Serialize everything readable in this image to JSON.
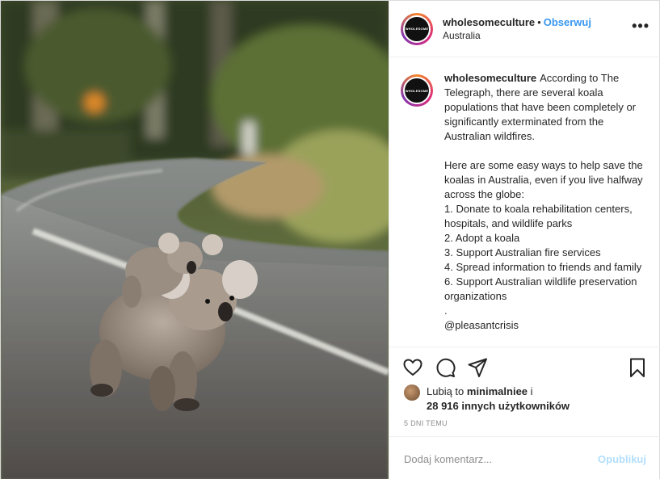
{
  "post": {
    "username": "wholesomeculture",
    "separator": "•",
    "follow_label": "Obserwuj",
    "location": "Australia",
    "more_label": "•••",
    "avatar_text": "WHOLESOME",
    "caption": "According to The Telegraph, there are several koala populations that have been completely or significantly exterminated from the Australian wildfires.\n\nHere are some easy ways to help save the koalas in Australia, even if you live halfway across the globe:\n1. Donate to koala rehabilitation centers, hospitals, and wildlife parks\n2. Adopt a koala\n3. Support Australian fire services\n4. Spread information to friends and family\n6. Support Australian wildlife preservation organizations\n.\n@pleasantcrisis",
    "likes_prefix": "Lubią to",
    "likes_user": "minimalniee",
    "likes_conj": "i",
    "likes_count": "28 916 innych użytkowników",
    "time_ago": "5 DNI TEMU",
    "comment_placeholder": "Dodaj komentarz...",
    "publish_label": "Opublikuj"
  },
  "colors": {
    "accent": "#3897f0",
    "publish_disabled": "#b2dffc",
    "muted": "#8e8e8e"
  },
  "icons": [
    "heart-icon",
    "comment-icon",
    "share-icon",
    "bookmark-icon",
    "more-icon"
  ]
}
